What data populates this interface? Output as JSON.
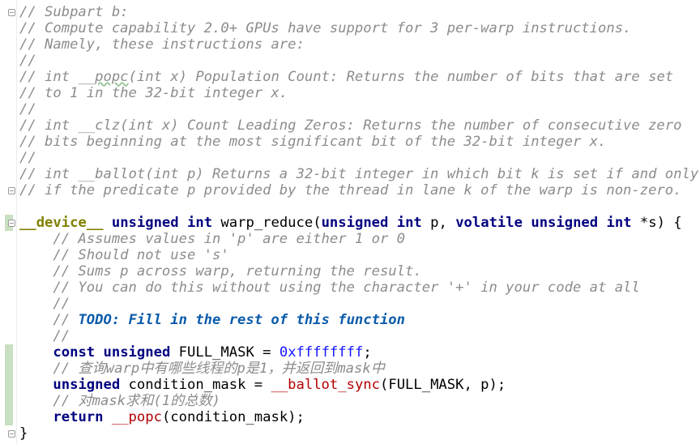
{
  "lines": {
    "l1": "// Subpart b:",
    "l2": "// Compute capability 2.0+ GPUs have support for 3 per-warp instructions.",
    "l3": "// Namely, these instructions are:",
    "l4": "//",
    "l5a": "// int __",
    "l5b": "popc",
    "l5c": "(int x) Population Count: Returns the number of bits that are set",
    "l6": "// to 1 in the 32-bit integer x.",
    "l7": "//",
    "l8": "// int __clz(int x) Count Leading Zeros: Returns the number of consecutive zero",
    "l9": "// bits beginning at the most significant bit of the 32-bit integer x.",
    "l10": "//",
    "l11": "// int __ballot(int p) Returns a 32-bit integer in which bit k is set if and only",
    "l12": "// if the predicate p provided by the thread in lane k of the warp is non-zero.",
    "l13": ""
  },
  "signature": {
    "device": "__device__",
    "unsigned1": "unsigned",
    "int1": "int",
    "name": " warp_reduce(",
    "unsigned2": "unsigned",
    "int2": "int",
    "p": " p, ",
    "volatile": "volatile",
    "unsigned3": "unsigned",
    "int3": "int",
    "star_s": " *s) {"
  },
  "body": {
    "c1": "    // Assumes values in 'p' are either 1 or 0",
    "c2": "    // Should not use 's'",
    "c3": "    // Sums p across warp, returning the result.",
    "c4": "    // You can do this without using the character '+' in your code at all",
    "c5": "    //",
    "todo_prefix": "    // ",
    "todo": "TODO: Fill in the rest of this function",
    "c6": "    //",
    "const_kw": "const",
    "unsigned_kw": "unsigned",
    "full_mask_decl": " FULL_MASK = ",
    "full_mask_val": "0xffffffff",
    "semicolon": ";",
    "c7": "    // 查询warp中有哪些线程的p是1，并返回到mask中",
    "unsigned_kw2": "unsigned",
    "cond_decl": " condition_mask = ",
    "ballot_fn": "__ballot_sync",
    "ballot_args": "(FULL_MASK, p);",
    "c8": "    // 对mask求和(1的总数)",
    "return_kw": "return",
    "popc_fn": "__popc",
    "popc_args": "(condition_mask);",
    "close": "}"
  },
  "colors": {
    "comment": "#8c8c8c",
    "keyword": "#000080",
    "macro": "#808000",
    "number": "#1515ff",
    "function": "#b20000",
    "todo": "#0b5bab",
    "change_bar": "#c9dfc1"
  }
}
